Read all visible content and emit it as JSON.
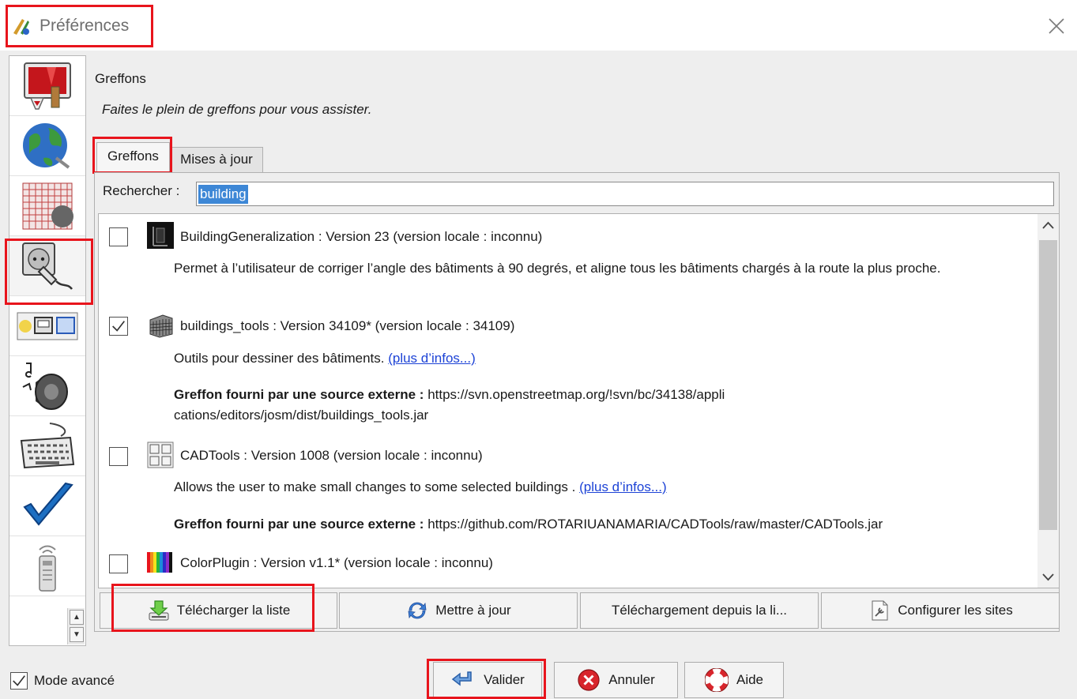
{
  "window": {
    "title": "Préférences"
  },
  "sidebar": {
    "items": [
      {
        "icon": "display-settings-icon"
      },
      {
        "icon": "globe-connection-icon"
      },
      {
        "icon": "projection-grid-icon"
      },
      {
        "icon": "plug-socket-icon",
        "selected": true
      },
      {
        "icon": "toolbar-icons-icon"
      },
      {
        "icon": "audio-speaker-icon"
      },
      {
        "icon": "keyboard-shortcuts-icon"
      },
      {
        "icon": "validator-checkmark-icon"
      },
      {
        "icon": "remote-control-icon"
      }
    ]
  },
  "panel": {
    "title": "Greffons",
    "description": "Faites le plein de greffons pour vous assister."
  },
  "tabs": [
    {
      "label": "Greffons",
      "active": true
    },
    {
      "label": "Mises à jour",
      "active": false
    }
  ],
  "search": {
    "label": "Rechercher :",
    "value": "building"
  },
  "plugins": [
    {
      "name": "BuildingGeneralization : Version 23 (version locale : inconnu)",
      "checked": false,
      "icon": "building-generalization-icon",
      "description": "Permet à l’utilisateur de corriger l’angle des bâtiments à 90 degrés, et aligne tous les bâtiments chargés à la route la plus proche."
    },
    {
      "name": "buildings_tools : Version 34109* (version locale : 34109)",
      "checked": true,
      "icon": "buildings-tools-icon",
      "description": "Outils pour dessiner des bâtiments.",
      "more_link": "(plus d’infos...)",
      "source_label": "Greffon fourni par une source externe :",
      "source_url": "https://svn.openstreetmap.org/!svn/bc/34138/applications/editors/josm/dist/buildings_tools.jar"
    },
    {
      "name": "CADTools : Version 1008 (version locale : inconnu)",
      "checked": false,
      "icon": "cadtools-icon",
      "description": "Allows the user to make small changes to some selected buildings .",
      "more_link": "(plus d’infos...)",
      "source_label": "Greffon fourni par une source externe :",
      "source_url": "https://github.com/ROTARIUANAMARIA/CADTools/raw/master/CADTools.jar"
    },
    {
      "name": "ColorPlugin : Version v1.1* (version locale : inconnu)",
      "checked": false,
      "icon": "color-plugin-icon"
    }
  ],
  "actions": {
    "download_list": "Télécharger la liste",
    "update": "Mettre à jour",
    "download_from": "Téléchargement depuis la li...",
    "configure_sites": "Configurer les sites"
  },
  "footer": {
    "advanced_mode": "Mode avancé",
    "advanced_checked": true,
    "ok": "Valider",
    "cancel": "Annuler",
    "help": "Aide"
  },
  "colors": {
    "highlight": "#e8141c",
    "selection": "#3d87d6",
    "link": "#1d43d6"
  }
}
